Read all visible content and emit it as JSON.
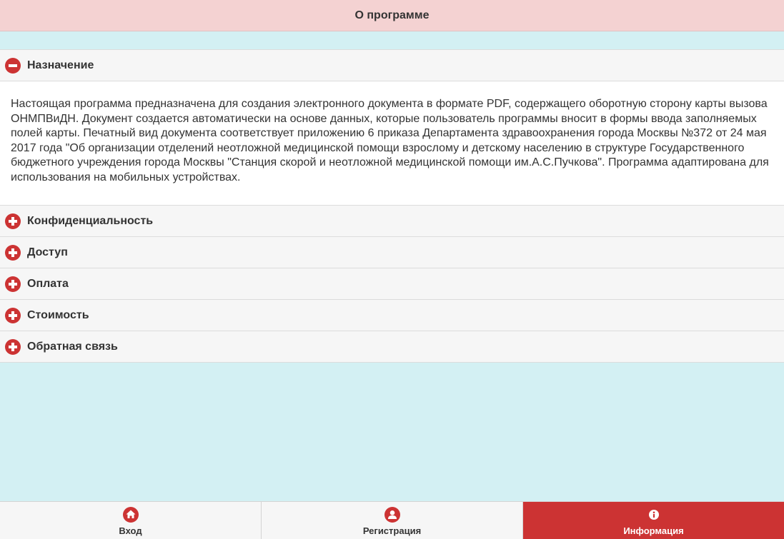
{
  "header": {
    "title": "О программе"
  },
  "accordion": {
    "items": [
      {
        "label": "Назначение",
        "expanded": true,
        "body": "Настоящая программа предназначена для создания электронного документа в формате PDF, содержащего оборотную сторону карты вызова ОНМПВиДН. Документ создается автоматически на основе данных, которые пользователь программы вносит в формы ввода заполняемых полей карты. Печатный вид документа соответствует приложению 6 приказа Департамента здравоохранения города Москвы №372 от 24 мая 2017 года \"Об организации отделений неотложной медицинской помощи взрослому и детскому населению в структуре Государственного бюджетного учреждения города Москвы \"Станция скорой и неотложной медицинской помощи им.А.С.Пучкова\". Программа адаптирована для использования на мобильных устройствах."
      },
      {
        "label": "Конфиденциальность",
        "expanded": false
      },
      {
        "label": "Доступ",
        "expanded": false
      },
      {
        "label": "Оплата",
        "expanded": false
      },
      {
        "label": "Стоимость",
        "expanded": false
      },
      {
        "label": "Обратная связь",
        "expanded": false
      }
    ],
    "icons": {
      "expanded": "minus-circle-icon",
      "collapsed": "plus-circle-icon"
    }
  },
  "tabbar": {
    "tabs": [
      {
        "label": "Вход",
        "icon": "home-icon",
        "active": false
      },
      {
        "label": "Регистрация",
        "icon": "user-icon",
        "active": false
      },
      {
        "label": "Информация",
        "icon": "info-icon",
        "active": true
      }
    ]
  },
  "colors": {
    "accent": "#cc3333",
    "header_bg": "#f4d2d2",
    "page_bg": "#d3f0f3",
    "item_bg": "#f6f6f6"
  }
}
